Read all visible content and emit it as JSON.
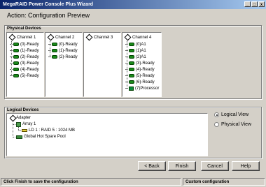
{
  "window": {
    "title": "MegaRAID Power Console Plus Wizard",
    "btn_min": "_",
    "btn_max": "□",
    "btn_close": "x"
  },
  "header": {
    "action": "Action:  Configuration Preview"
  },
  "physical": {
    "label": "Physical Devices",
    "channels": [
      {
        "name": "Channel 1",
        "devices": [
          "(0)-Ready",
          "(1)-Ready",
          "(2)-Ready",
          "(3)-Ready",
          "(4)-Ready",
          "(5)-Ready"
        ]
      },
      {
        "name": "Channel 2",
        "devices": [
          "(0)-Ready",
          "(1)-Ready",
          "(2)-Ready"
        ]
      },
      {
        "name": "Channel 3",
        "devices": []
      },
      {
        "name": "Channel 4",
        "devices": [
          "(0)A1",
          "(1)A1",
          "(2)A1",
          "(3)-Ready",
          "(4)-Ready",
          "(5)-Ready",
          "(6)-Ready",
          "(7)Processor"
        ]
      }
    ]
  },
  "logical": {
    "label": "Logical Devices",
    "adapter": "Adapter",
    "array": "Array 1",
    "ld": "LD 1 : RAID 5 : 1024 MB",
    "hotspare": "Global Hot Spare Pool"
  },
  "view": {
    "logical": "Logical View",
    "physical": "Physical View",
    "selected": "logical"
  },
  "buttons": {
    "back": "< Back",
    "finish": "Finish",
    "cancel": "Cancel",
    "help": "Help"
  },
  "status": {
    "left": "Click Finish to save the configuration",
    "right": "Custom configuration"
  }
}
